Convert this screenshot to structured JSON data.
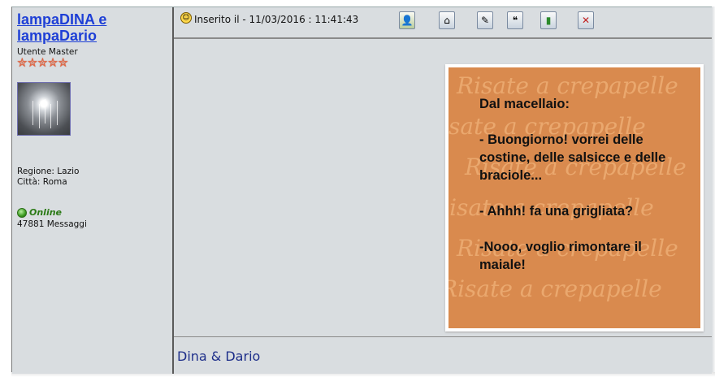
{
  "author": {
    "username": "lampaDINA e lampaDario",
    "rank": "Utente Master",
    "stars": 5,
    "region": "Regione: Lazio",
    "city": "Città: Roma",
    "status": "Online",
    "messages": "47881 Messaggi"
  },
  "post": {
    "posted_label": "Inserito il - 11/03/2016 : 11:41:43",
    "toolbar": [
      {
        "name": "profile",
        "icon": "user-profile-icon"
      },
      {
        "name": "home",
        "icon": "home-icon"
      },
      {
        "name": "edit",
        "icon": "edit-icon"
      },
      {
        "name": "quote",
        "icon": "quote-icon"
      },
      {
        "name": "bookmark",
        "icon": "bookmark-icon"
      },
      {
        "name": "delete",
        "icon": "delete-icon"
      }
    ],
    "image": {
      "text": "Dal macellaio:\n\n- Buongiorno! vorrei delle costine, delle salsicce e delle braciole...\n\n- Ahhh! fa una grigliata?\n\n-Nooo, voglio rimontare il maiale!",
      "watermark": "Risate a crepapelle"
    },
    "signature": "Dina & Dario"
  },
  "colors": {
    "link": "#1e3fd6",
    "panel_bg": "#d9dde0",
    "online": "#2b7a16",
    "image_bg": "#d98a4e",
    "signature": "#1e2f8a"
  }
}
